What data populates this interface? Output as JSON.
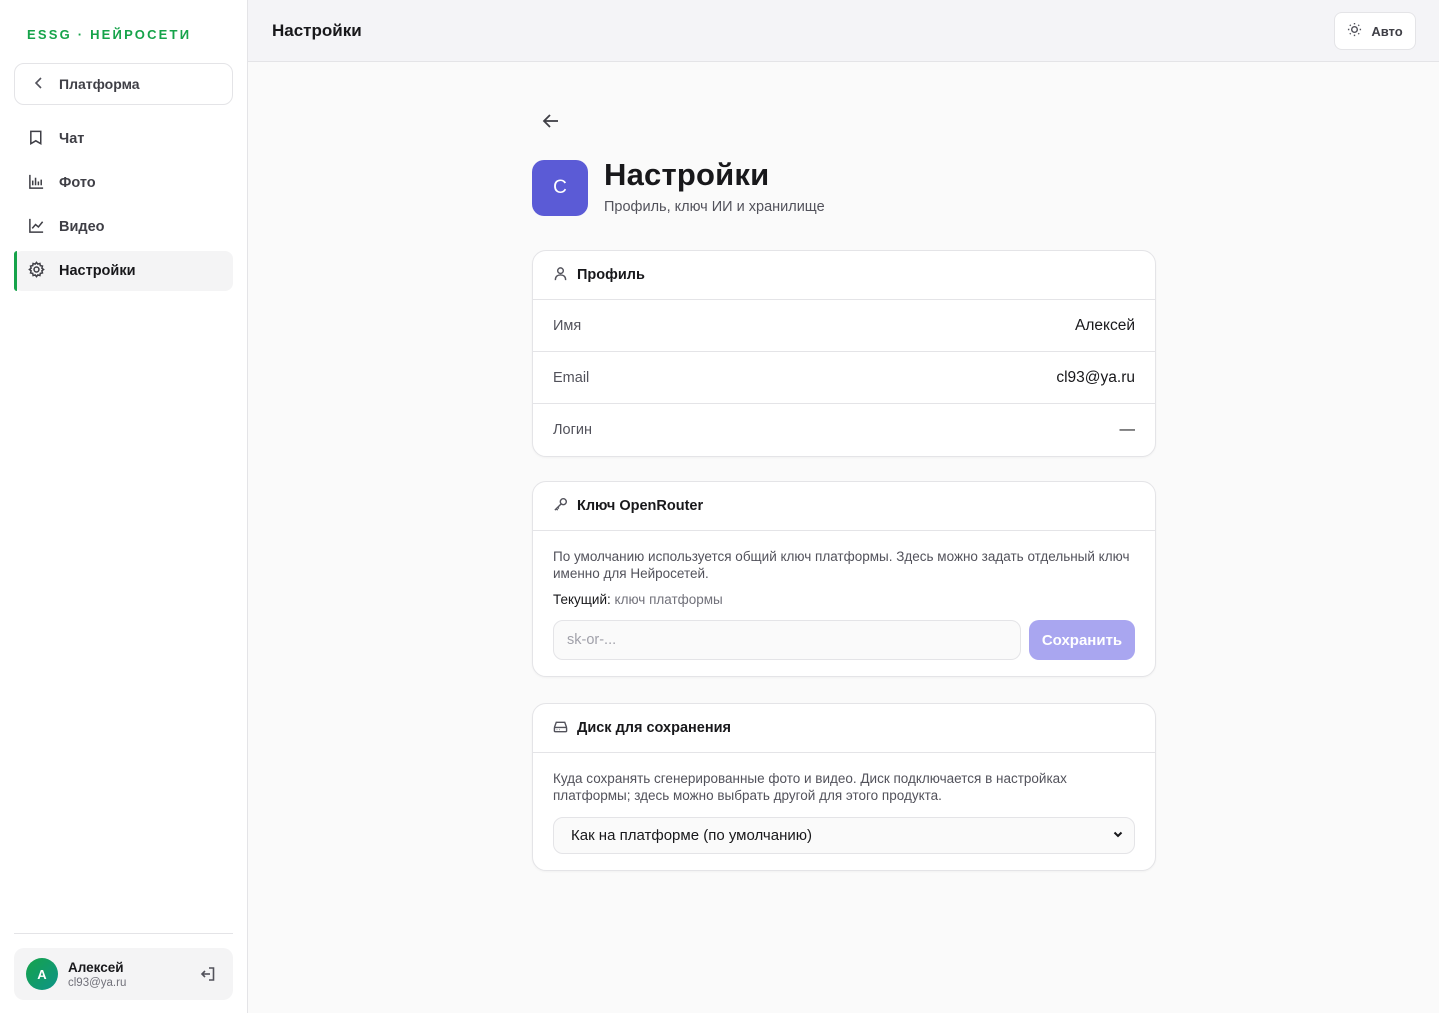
{
  "sidebar": {
    "brand": "ESSG · НЕЙРОСЕТИ",
    "platform_button": "Платформа",
    "items": [
      {
        "label": "Чат",
        "icon": "book-icon"
      },
      {
        "label": "Фото",
        "icon": "bar-chart-icon"
      },
      {
        "label": "Видео",
        "icon": "line-chart-icon"
      },
      {
        "label": "Настройки",
        "icon": "gear-icon",
        "active": true
      }
    ],
    "user": {
      "initial": "А",
      "name": "Алексей",
      "email": "cl93@ya.ru"
    }
  },
  "header": {
    "title": "Настройки",
    "theme_label": "Авто"
  },
  "page": {
    "avatar_letter": "С",
    "title": "Настройки",
    "subtitle": "Профиль, ключ ИИ и хранилище"
  },
  "profile": {
    "title": "Профиль",
    "rows": [
      {
        "label": "Имя",
        "value": "Алексей"
      },
      {
        "label": "Email",
        "value": "cl93@ya.ru"
      },
      {
        "label": "Логин",
        "value": "—"
      }
    ]
  },
  "openrouter": {
    "title": "Ключ OpenRouter",
    "description": "По умолчанию используется общий ключ платформы. Здесь можно задать отдельный ключ именно для Нейросетей.",
    "current_label": "Текущий:",
    "current_value": "ключ платформы",
    "input_value": "",
    "input_placeholder": "sk-or-...",
    "save_label": "Сохранить"
  },
  "disk": {
    "title": "Диск для сохранения",
    "description": "Куда сохранять сгенерированные фото и видео. Диск подключается в настройках платформы; здесь можно выбрать другой для этого продукта.",
    "selected": "Как на платформе (по умолчанию)"
  },
  "colors": {
    "brand_green": "#16a34a",
    "accent_purple": "#5b5bd6",
    "save_disabled": "#a9a6f0"
  }
}
